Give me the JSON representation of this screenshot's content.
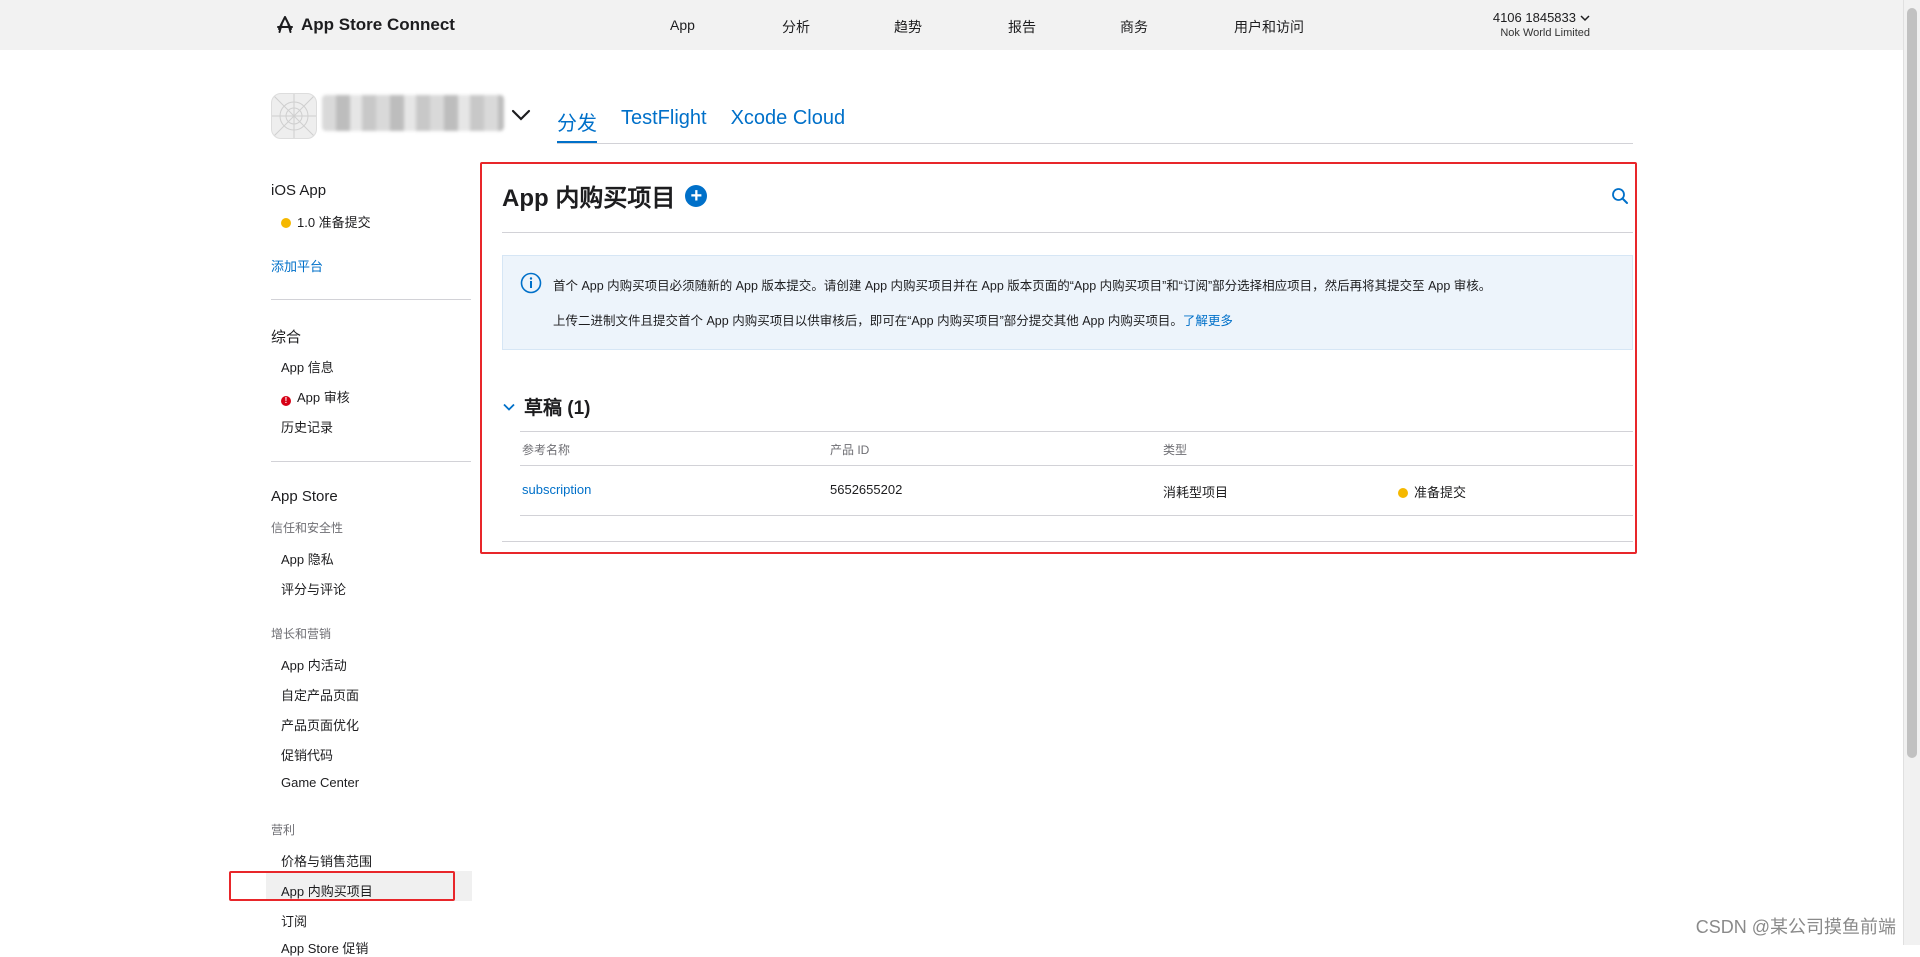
{
  "topbar": {
    "brand": "App Store Connect",
    "nav": [
      {
        "label": "App",
        "active": true
      },
      {
        "label": "分析"
      },
      {
        "label": "趋势"
      },
      {
        "label": "报告"
      },
      {
        "label": "商务"
      },
      {
        "label": "用户和访问"
      }
    ],
    "account_id": "4106 1845833",
    "account_name": "Nok World Limited"
  },
  "app_header": {
    "tabs": [
      {
        "label": "分发",
        "active": true
      },
      {
        "label": "TestFlight"
      },
      {
        "label": "Xcode Cloud"
      }
    ]
  },
  "sidebar": {
    "platform": "iOS App",
    "version_status": "1.0 准备提交",
    "add_platform": "添加平台",
    "general_title": "综合",
    "general_items": [
      "App 信息",
      "App 审核",
      "历史记录"
    ],
    "appstore_title": "App Store",
    "trust_category": "信任和安全性",
    "trust_items": [
      "App 隐私",
      "评分与评论"
    ],
    "growth_category": "增长和营销",
    "growth_items": [
      "App 内活动",
      "自定产品页面",
      "产品页面优化",
      "促销代码",
      "Game Center"
    ],
    "monetize_category": "营利",
    "monetize_items": [
      "价格与销售范围",
      "App 内购买项目",
      "订阅",
      "App Store 促销"
    ],
    "selected_item": "App 内购买项目"
  },
  "main": {
    "title": "App 内购买项目",
    "info_line1": "首个 App 内购买项目必须随新的 App 版本提交。请创建 App 内购买项目并在 App 版本页面的“App 内购买项目”和“订阅”部分选择相应项目，然后再将其提交至 App 审核。",
    "info_line2": "上传二进制文件且提交首个 App 内购买项目以供审核后，即可在“App 内购买项目”部分提交其他 App 内购买项目。",
    "learn_more": "了解更多",
    "section_title": "草稿 (1)",
    "table": {
      "headers": [
        "参考名称",
        "产品 ID",
        "类型"
      ],
      "rows": [
        {
          "name": "subscription",
          "product_id": "5652655202",
          "type": "消耗型项目",
          "status": "准备提交"
        }
      ]
    }
  },
  "watermark": "CSDN @某公司摸鱼前端",
  "colors": {
    "accent": "#0070c9",
    "highlight_box": "#e8262a",
    "status_yellow": "#f5b800",
    "status_red": "#d70015"
  }
}
